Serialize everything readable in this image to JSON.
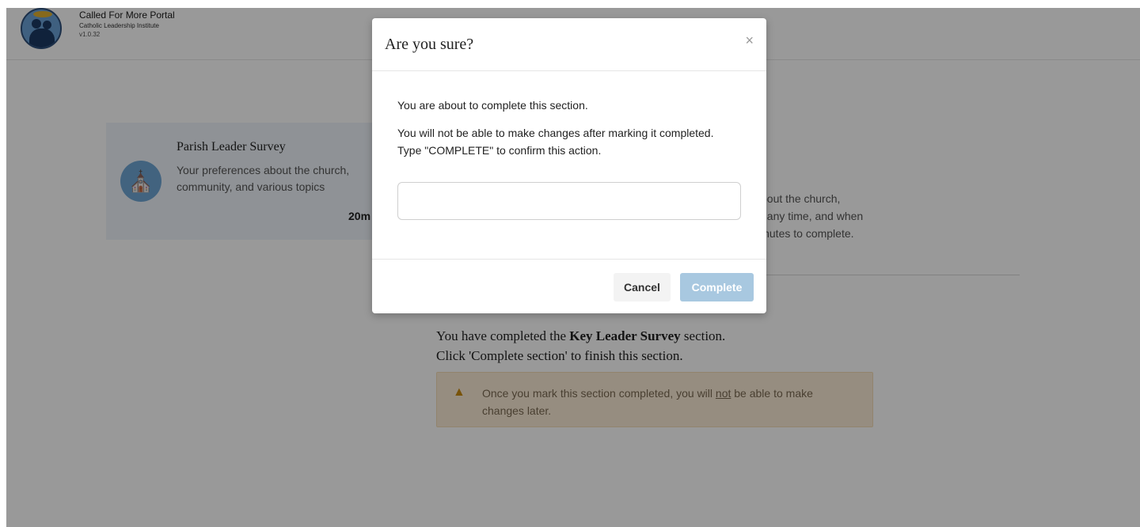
{
  "header": {
    "title": "Called For More Portal",
    "subtitle": "Catholic Leadership Institute",
    "version": "v1.0.32"
  },
  "card": {
    "title": "Parish Leader Survey",
    "description": "Your preferences about the church, community, and various topics",
    "time": "20m",
    "icon": "church-icon"
  },
  "background_lines": [
    "bout the church,",
    "t any time, and when",
    "inutes to complete."
  ],
  "completion": {
    "line1_prefix": "You have completed the ",
    "line1_bold": "Key Leader Survey",
    "line1_suffix": " section.",
    "line2": "Click 'Complete section' to finish this section."
  },
  "warning": {
    "prefix": "Once you mark this section completed, you will ",
    "underlined": "not",
    "suffix": " be able to make changes later.",
    "icon": "warning-icon",
    "color": "#c88a12"
  },
  "modal": {
    "title": "Are you sure?",
    "close": "×",
    "line1": "You are about to complete this section.",
    "line2": "You will not be able to make changes after marking it completed.",
    "line3": "Type \"COMPLETE\" to confirm this action.",
    "input_value": "",
    "cancel_label": "Cancel",
    "complete_label": "Complete"
  },
  "colors": {
    "accent": "#a8c8e0",
    "card_bg": "#eef4fa",
    "warning_bg": "#fbecd6"
  }
}
